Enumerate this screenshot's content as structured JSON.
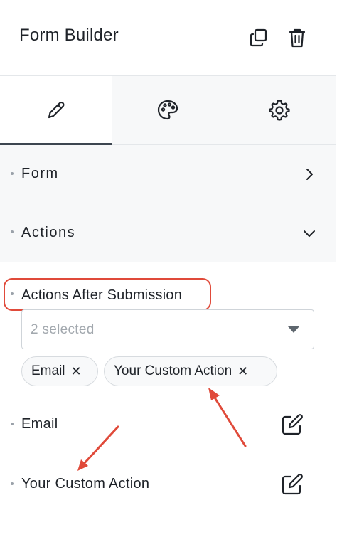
{
  "header": {
    "title": "Form Builder",
    "duplicate_icon": "copy-icon",
    "delete_icon": "trash-icon"
  },
  "tabs": [
    {
      "icon": "pencil-icon",
      "active": true
    },
    {
      "icon": "palette-icon",
      "active": false
    },
    {
      "icon": "gear-icon",
      "active": false
    }
  ],
  "sections": {
    "form": {
      "label": "Form",
      "icon": "chevron-right-icon"
    },
    "actions": {
      "label": "Actions",
      "icon": "chevron-down-icon"
    }
  },
  "actions_after_submission": {
    "label": "Actions After Submission",
    "select_value": "2 selected",
    "chips": [
      "Email",
      "Your Custom Action"
    ],
    "remove_glyph": "✕"
  },
  "action_rows": [
    {
      "label": "Email",
      "icon": "edit-icon"
    },
    {
      "label": "Your Custom Action",
      "icon": "edit-icon"
    }
  ],
  "colors": {
    "annotation": "#e04a3a",
    "section_bg": "#f7f8f9",
    "border": "#e4e7ea"
  }
}
